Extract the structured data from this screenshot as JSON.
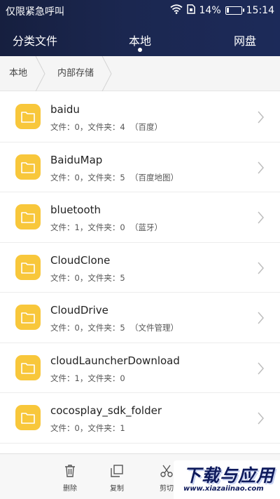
{
  "status_bar": {
    "carrier": "仅限紧急呼叫",
    "battery_percent": "14%",
    "time": "15:14",
    "battery_level": 0.14
  },
  "tabs": {
    "categories": "分类文件",
    "local": "本地",
    "cloud": "网盘",
    "active": "local"
  },
  "breadcrumb": {
    "root": "本地",
    "current": "内部存储"
  },
  "files": [
    {
      "name": "baidu",
      "meta": "文件：0，文件夹：4  （百度）"
    },
    {
      "name": "BaiduMap",
      "meta": "文件：0，文件夹：5  （百度地图）"
    },
    {
      "name": "bluetooth",
      "meta": "文件：1，文件夹：0  （蓝牙）"
    },
    {
      "name": "CloudClone",
      "meta": "文件：0，文件夹：5"
    },
    {
      "name": "CloudDrive",
      "meta": "文件：0，文件夹：5  （文件管理）"
    },
    {
      "name": "cloudLauncherDownload",
      "meta": "文件：1，文件夹：0"
    },
    {
      "name": "cocosplay_sdk_folder",
      "meta": "文件：0，文件夹：1"
    }
  ],
  "toolbar": {
    "delete": "删除",
    "copy": "复制",
    "cut": "剪切"
  },
  "watermark": {
    "title": "下载与应用",
    "url": "www.xiazaiinao.com"
  },
  "colors": {
    "header_bg": "#1b2750",
    "folder": "#f8c73b",
    "watermark": "#0e1a5c"
  },
  "icons": [
    "wifi-icon",
    "sim-icon",
    "battery-icon",
    "folder-icon",
    "chevron-right-icon",
    "trash-icon",
    "copy-icon",
    "scissors-icon"
  ]
}
